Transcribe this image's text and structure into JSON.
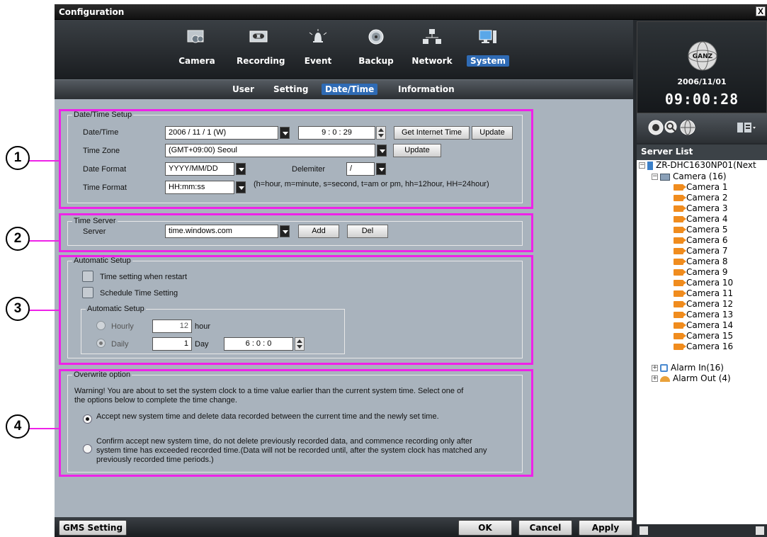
{
  "window": {
    "title": "Configuration",
    "close_glyph": "X"
  },
  "nav": {
    "items": [
      {
        "label": "Camera",
        "icon": "camera-icon"
      },
      {
        "label": "Recording",
        "icon": "recording-icon"
      },
      {
        "label": "Event",
        "icon": "event-icon"
      },
      {
        "label": "Backup",
        "icon": "backup-icon"
      },
      {
        "label": "Network",
        "icon": "network-icon"
      },
      {
        "label": "System",
        "icon": "system-icon",
        "active": true
      }
    ],
    "subitems": [
      {
        "label": "User"
      },
      {
        "label": "Setting"
      },
      {
        "label": "Date/Time",
        "active": true
      },
      {
        "label": "Information"
      }
    ]
  },
  "datetime_setup": {
    "title": "Date/Time Setup",
    "datetime_label": "Date/Time",
    "date_value": "2006   /  11  /  1     (W)",
    "time_value": "9   :   0   :  29",
    "get_internet_time_button": "Get Internet Time",
    "update_button": "Update",
    "timezone_label": "Time Zone",
    "timezone_value": "(GMT+09:00) Seoul",
    "timezone_update_button": "Update",
    "date_format_label": "Date Format",
    "date_format_value": "YYYY/MM/DD",
    "delimiter_label": "Delemiter",
    "delimiter_value": "/",
    "time_format_label": "Time Format",
    "time_format_value": "HH:mm:ss",
    "time_format_hint": "(h=hour, m=minute, s=second, t=am or pm, hh=12hour, HH=24hour)"
  },
  "time_server": {
    "title": "Time Server",
    "server_label": "Server",
    "server_value": "time.windows.com",
    "add_button": "Add",
    "del_button": "Del"
  },
  "automatic_setup": {
    "title": "Automatic Setup",
    "restart_label": "Time setting when restart",
    "schedule_label": "Schedule Time Setting",
    "inner_title": "Automatic Setup",
    "hourly_label": "Hourly",
    "hourly_value": "12",
    "hourly_unit": "hour",
    "daily_label": "Daily",
    "daily_value": "1",
    "daily_unit": "Day",
    "daily_time": "6   :   0   :   0"
  },
  "overwrite": {
    "title": "Overwrite option",
    "warning": "Warning! You are about to set the system clock to a time value earlier than the current system time. Select one of the options below to complete the time change.",
    "option1": "Accept new system time and delete data recorded between the current time and the newly set time.",
    "option2": "Confirm accept new system time, do not delete previously recorded data, and commence recording only after system time has exceeded recorded time.(Data will not be recorded until, after the system clock has matched any previously recorded time periods.)"
  },
  "callouts": [
    "1",
    "2",
    "3",
    "4"
  ],
  "bottom": {
    "gms_button": "GMS Setting",
    "ok_button": "OK",
    "cancel_button": "Cancel",
    "apply_button": "Apply"
  },
  "right": {
    "logo_text": "GANZ",
    "date": "2006/11/01",
    "time": "09:00:28",
    "server_list_title": "Server List",
    "tree": {
      "root": "ZR-DHC1630NP01(Next",
      "camera_group": "Camera (16)",
      "cameras": [
        "Camera 1",
        "Camera 2",
        "Camera 3",
        "Camera 4",
        "Camera 5",
        "Camera 6",
        "Camera 7",
        "Camera 8",
        "Camera 9",
        "Camera 10",
        "Camera 11",
        "Camera 12",
        "Camera 13",
        "Camera 14",
        "Camera 15",
        "Camera 16"
      ],
      "alarm_in": "Alarm In(16)",
      "alarm_out": "Alarm Out (4)"
    }
  },
  "colors": {
    "highlight": "#ee22e8",
    "active_tab": "#2f6bb5",
    "panel": "#a9b3bd"
  }
}
